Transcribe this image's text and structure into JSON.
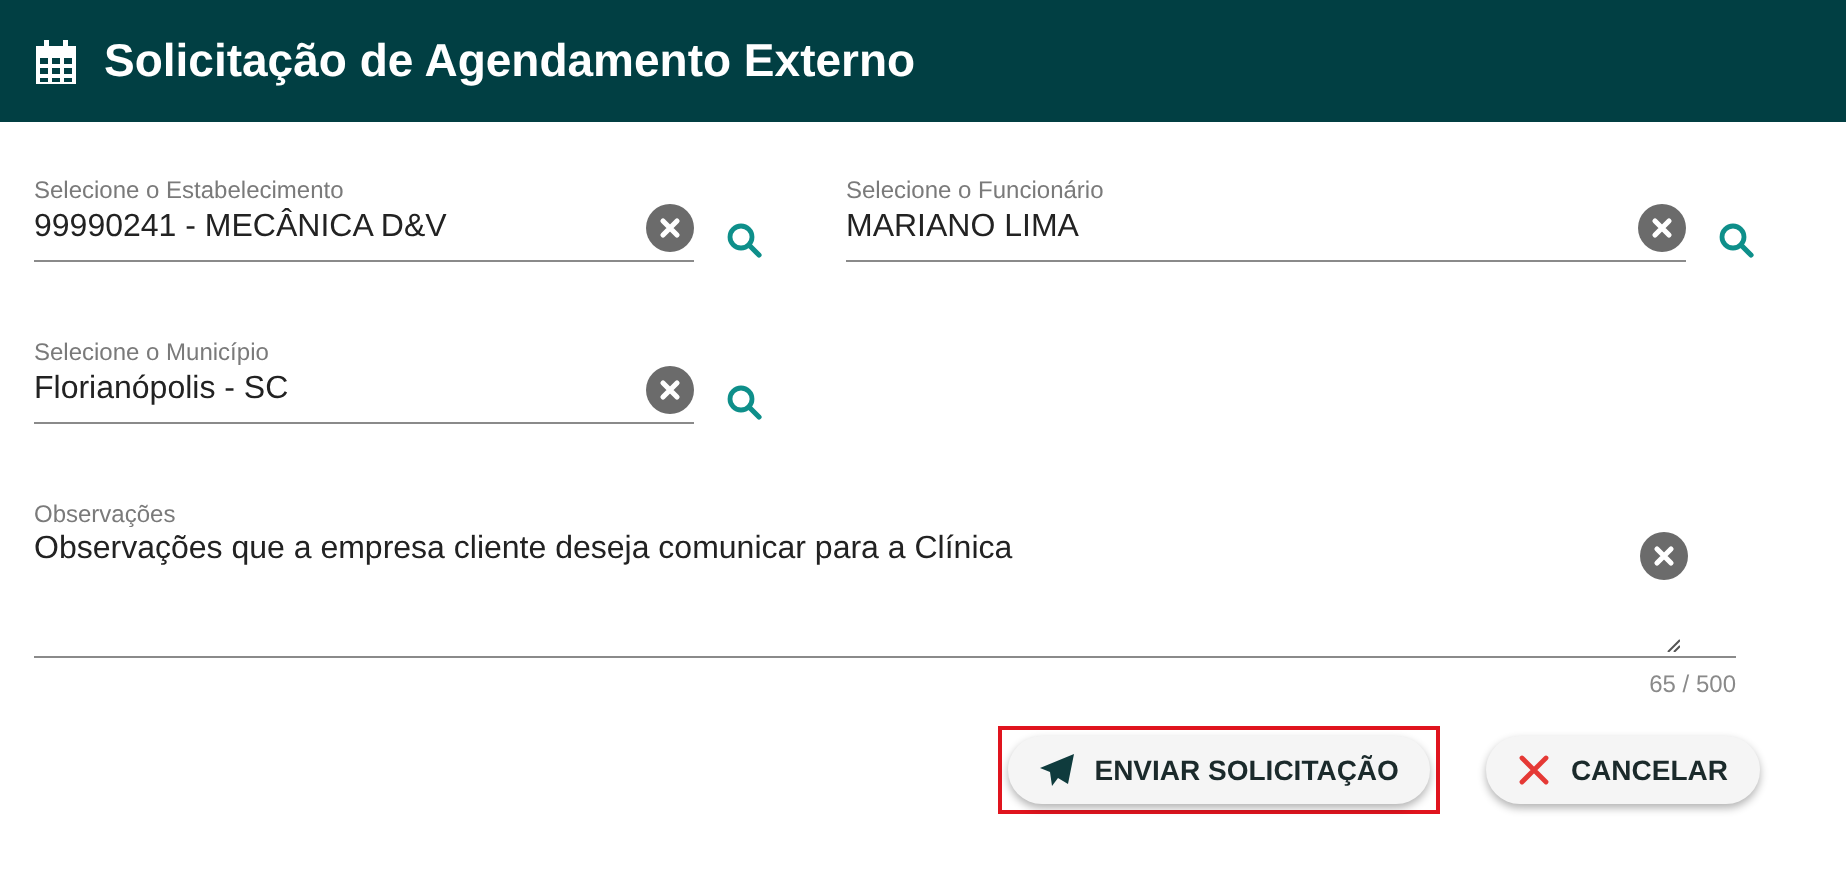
{
  "header": {
    "title": "Solicitação de Agendamento Externo"
  },
  "fields": [
    {
      "label": "Selecione o Estabelecimento",
      "value": "99990241 - MECÂNICA D&V"
    },
    {
      "label": "Selecione o Funcionário",
      "value": "MARIANO LIMA"
    },
    {
      "label": "Selecione o Município",
      "value": "Florianópolis - SC"
    }
  ],
  "notes": {
    "label": "Observações",
    "value": "Observações que a empresa cliente deseja comunicar para a Clínica",
    "counter": "65 / 500"
  },
  "buttons": [
    {
      "kind": "send",
      "label": "ENVIAR SOLICITAÇÃO",
      "highlighted": true
    },
    {
      "kind": "cancel",
      "label": "CANCELAR",
      "highlighted": false
    }
  ]
}
